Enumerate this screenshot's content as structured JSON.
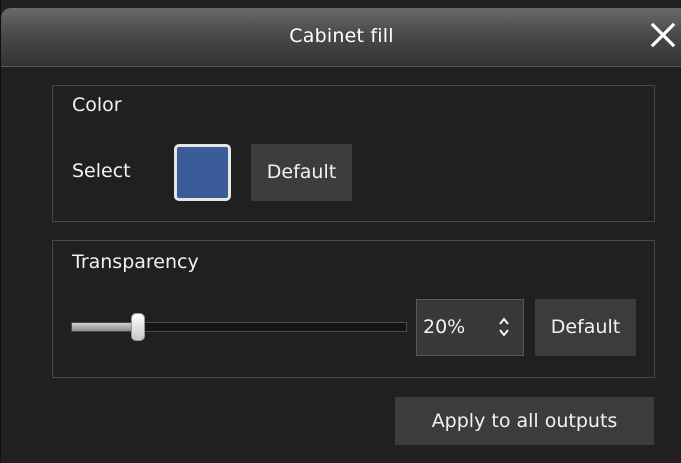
{
  "dialog": {
    "title": "Cabinet fill",
    "close_icon": "close-icon"
  },
  "color_group": {
    "label": "Color",
    "select_label": "Select",
    "swatch_color": "#3a5c99",
    "default_label": "Default"
  },
  "transparency_group": {
    "label": "Transparency",
    "slider_value": 0.2,
    "value_text": "20%",
    "spin_icon": "spin-arrows-icon",
    "default_label": "Default"
  },
  "apply_label": "Apply to all outputs"
}
